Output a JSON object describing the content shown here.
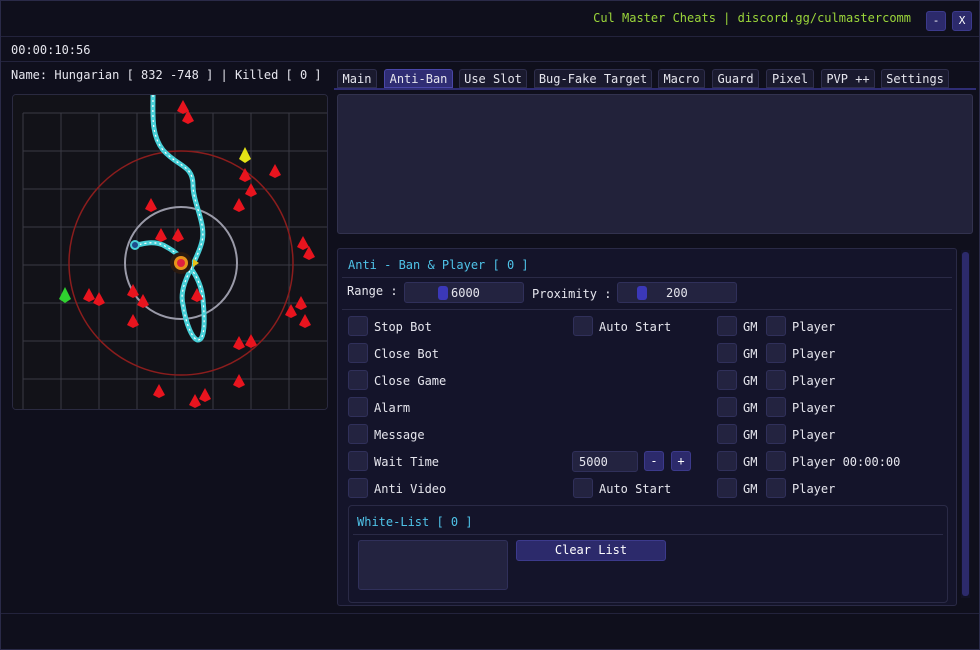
{
  "app": {
    "title": "Cul Master Cheats | discord.gg/culmastercomm",
    "minimize_label": "-",
    "close_label": "X"
  },
  "session": {
    "timer": "00:00:10:56",
    "status": "Name: Hungarian [ 832 -748 ] | Killed [ 0 ]"
  },
  "tabs": [
    {
      "label": "Main"
    },
    {
      "label": "Anti-Ban",
      "active": true
    },
    {
      "label": "Use Slot"
    },
    {
      "label": "Bug-Fake Target"
    },
    {
      "label": "Macro"
    },
    {
      "label": "Guard"
    },
    {
      "label": "Pixel"
    },
    {
      "label": "PVP ++"
    },
    {
      "label": "Settings"
    }
  ],
  "anti_ban": {
    "title": "Anti - Ban & Player [ 0 ]",
    "range_label": "Range :",
    "range_value": "6000",
    "proximity_label": "Proximity :",
    "proximity_value": "200",
    "options": [
      {
        "label": "Stop Bot",
        "extra": "Auto Start",
        "gm": "GM",
        "player": "Player"
      },
      {
        "label": "Close Bot",
        "gm": "GM",
        "player": "Player"
      },
      {
        "label": "Close Game",
        "gm": "GM",
        "player": "Player"
      },
      {
        "label": "Alarm",
        "gm": "GM",
        "player": "Player"
      },
      {
        "label": "Message",
        "gm": "GM",
        "player": "Player"
      },
      {
        "label": "Wait Time",
        "wait_value": "5000",
        "minus": "-",
        "plus": "+",
        "gm": "GM",
        "player": "Player 00:00:00"
      },
      {
        "label": "Anti Video",
        "extra": "Auto Start",
        "gm": "GM",
        "player": "Player"
      }
    ]
  },
  "whitelist": {
    "title": "White-List [ 0 ]",
    "clear_label": "Clear List"
  },
  "map": {
    "colors": {
      "grid": "#3a3a44",
      "background": "#121218",
      "range_circle": "#8b1d1d",
      "proximity_circle": "#9a9aa8",
      "path": "#48d0d8",
      "enemy": "#e8141e",
      "npc": "#e4e416",
      "party": "#2fd12f"
    }
  }
}
